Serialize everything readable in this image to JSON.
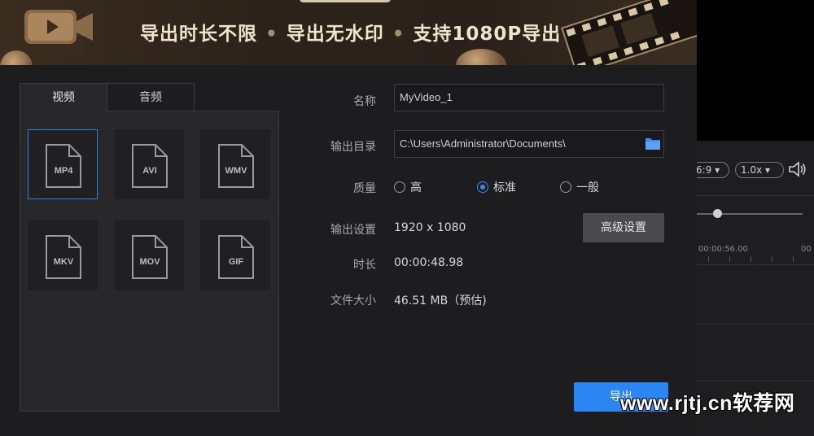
{
  "banner": {
    "slogan_1": "导出时长不限",
    "slogan_2": "导出无水印",
    "slogan_3": "支持1080P导出",
    "separator": "•"
  },
  "editor_bg": {
    "ratio": "6:9",
    "speed": "1.0x",
    "timecode_1": "00:00:56.00",
    "timecode_2": "00"
  },
  "tabs": [
    {
      "label": "视频",
      "active": true
    },
    {
      "label": "音频",
      "active": false
    }
  ],
  "formats": [
    {
      "label": "MP4",
      "selected": true
    },
    {
      "label": "AVI",
      "selected": false
    },
    {
      "label": "WMV",
      "selected": false
    },
    {
      "label": "MKV",
      "selected": false
    },
    {
      "label": "MOV",
      "selected": false
    },
    {
      "label": "GIF",
      "selected": false
    }
  ],
  "form": {
    "name_label": "名称",
    "name_value": "MyVideo_1",
    "dir_label": "输出目录",
    "dir_value": "C:\\Users\\Administrator\\Documents\\",
    "quality_label": "质量",
    "quality_options": [
      {
        "label": "高",
        "selected": false
      },
      {
        "label": "标准",
        "selected": true
      },
      {
        "label": "一般",
        "selected": false
      }
    ],
    "settings_label": "输出设置",
    "settings_value": "1920 x 1080",
    "advanced_button": "高级设置",
    "duration_label": "时长",
    "duration_value": "00:00:48.98",
    "size_label": "文件大小",
    "size_value": "46.51 MB（预估)"
  },
  "export_button": "导出",
  "watermark": "www.rjtj.cn软荐网",
  "colors": {
    "accent": "#2b86f3",
    "radio_on": "#3d8bf1",
    "selected_border": "#2f7fe6"
  },
  "icons": {
    "folder": "folder-icon",
    "volume": "volume-icon",
    "camera": "video-camera-icon",
    "file": "file-icon"
  }
}
